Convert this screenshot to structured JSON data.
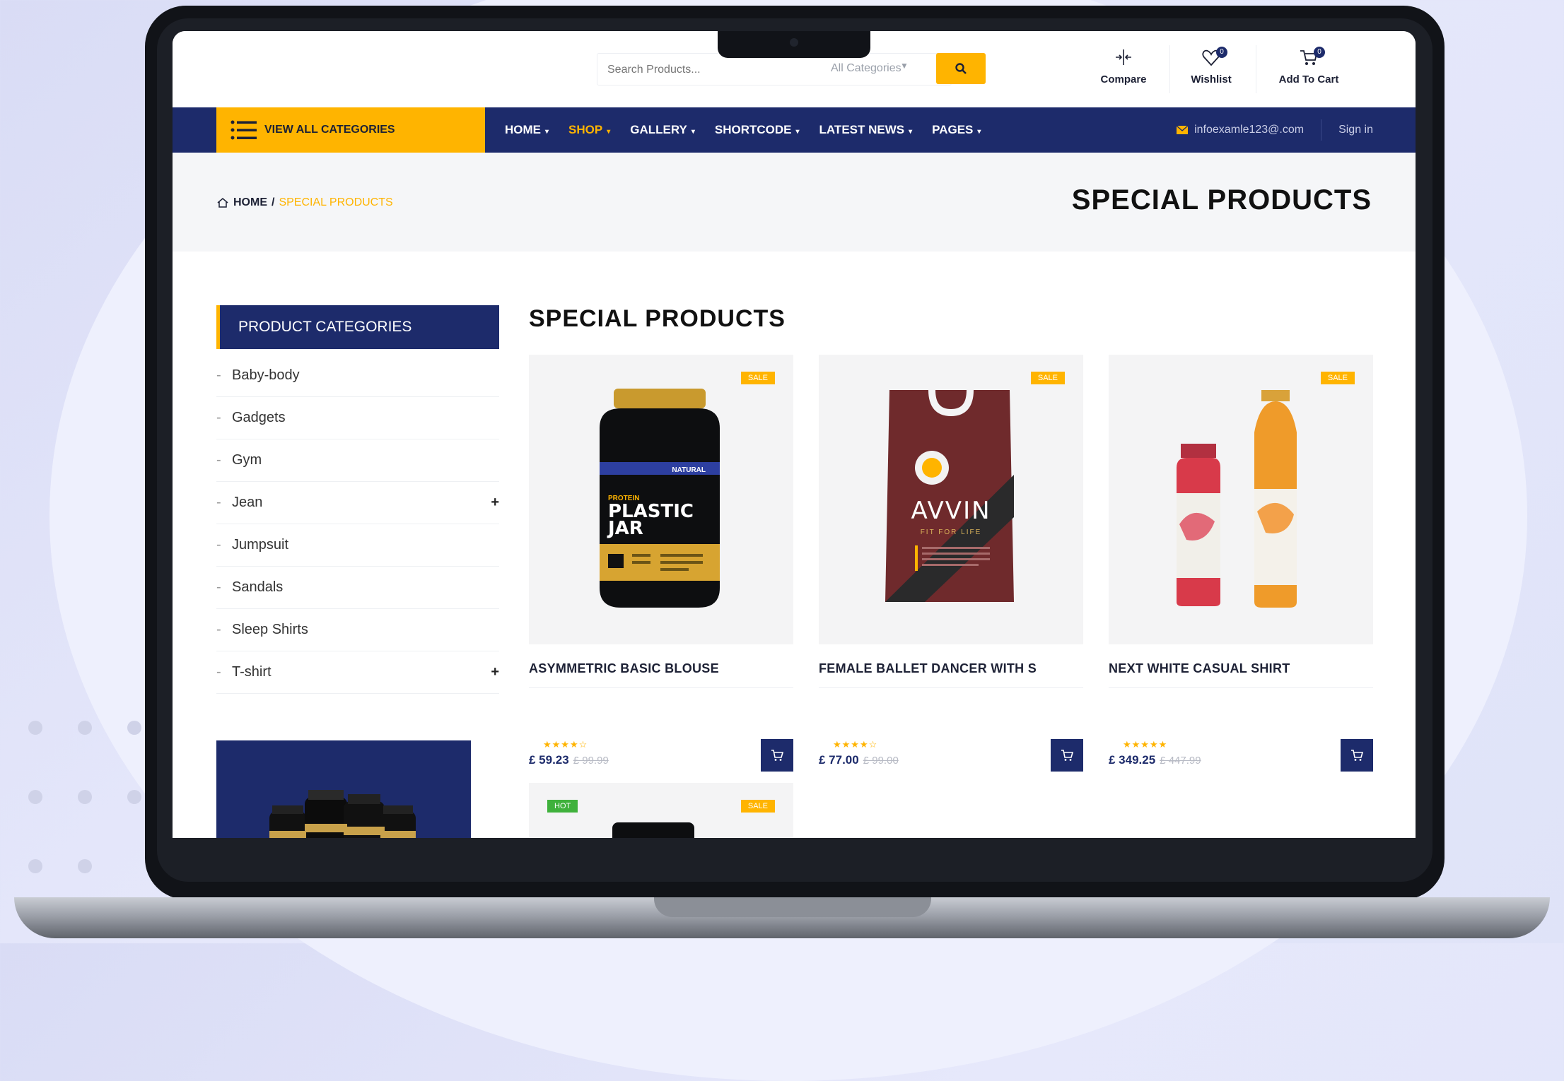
{
  "header": {
    "search_placeholder": "Search Products...",
    "category_select": "All Categories",
    "compare_label": "Compare",
    "wishlist_label": "Wishlist",
    "wishlist_count": "0",
    "cart_label": "Add To Cart",
    "cart_count": "0"
  },
  "nav": {
    "all_categories_label": "VIEW ALL CATEGORIES",
    "items": [
      {
        "label": "HOME"
      },
      {
        "label": "SHOP"
      },
      {
        "label": "GALLERY"
      },
      {
        "label": "SHORTCODE"
      },
      {
        "label": "LATEST NEWS"
      },
      {
        "label": "PAGES"
      }
    ],
    "active": "SHOP",
    "email": "infoexamle123@.com",
    "signin": "Sign in"
  },
  "breadcrumb": {
    "home": "HOME",
    "separator": "/",
    "current": "SPECIAL PRODUCTS"
  },
  "page_title": "SPECIAL PRODUCTS",
  "sidebar": {
    "heading": "PRODUCT CATEGORIES",
    "categories": [
      {
        "label": "Baby-body"
      },
      {
        "label": "Gadgets"
      },
      {
        "label": "Gym"
      },
      {
        "label": "Jean"
      },
      {
        "label": "Jumpsuit"
      },
      {
        "label": "Sandals"
      },
      {
        "label": "Sleep Shirts"
      },
      {
        "label": "T-shirt"
      }
    ]
  },
  "main": {
    "title": "SPECIAL PRODUCTS",
    "products": [
      {
        "name": "ASYMMETRIC BASIC BLOUSE",
        "price": "£ 59.23",
        "old_price": "£ 99.99",
        "tag": "SALE",
        "rating": 4,
        "image_text": {
          "brand": "NATURAL",
          "kicker": "PROTEIN",
          "title1": "PLASTIC",
          "title2": "JAR"
        }
      },
      {
        "name": "FEMALE BALLET DANCER WITH S",
        "price": "£ 77.00",
        "old_price": "£ 99.00",
        "tag": "SALE",
        "rating": 4,
        "image_text": {
          "brand": "AVVIN",
          "tagline": "FIT FOR LIFE"
        }
      },
      {
        "name": "NEXT WHITE CASUAL SHIRT",
        "price": "£ 349.25",
        "old_price": "£ 447.99",
        "tag": "SALE",
        "rating": 5
      }
    ],
    "next_row": {
      "hot": "HOT",
      "sale": "SALE"
    }
  },
  "colors": {
    "brand_navy": "#1d2b6b",
    "accent_yellow": "#ffb400",
    "hot_green": "#3fb13c"
  }
}
